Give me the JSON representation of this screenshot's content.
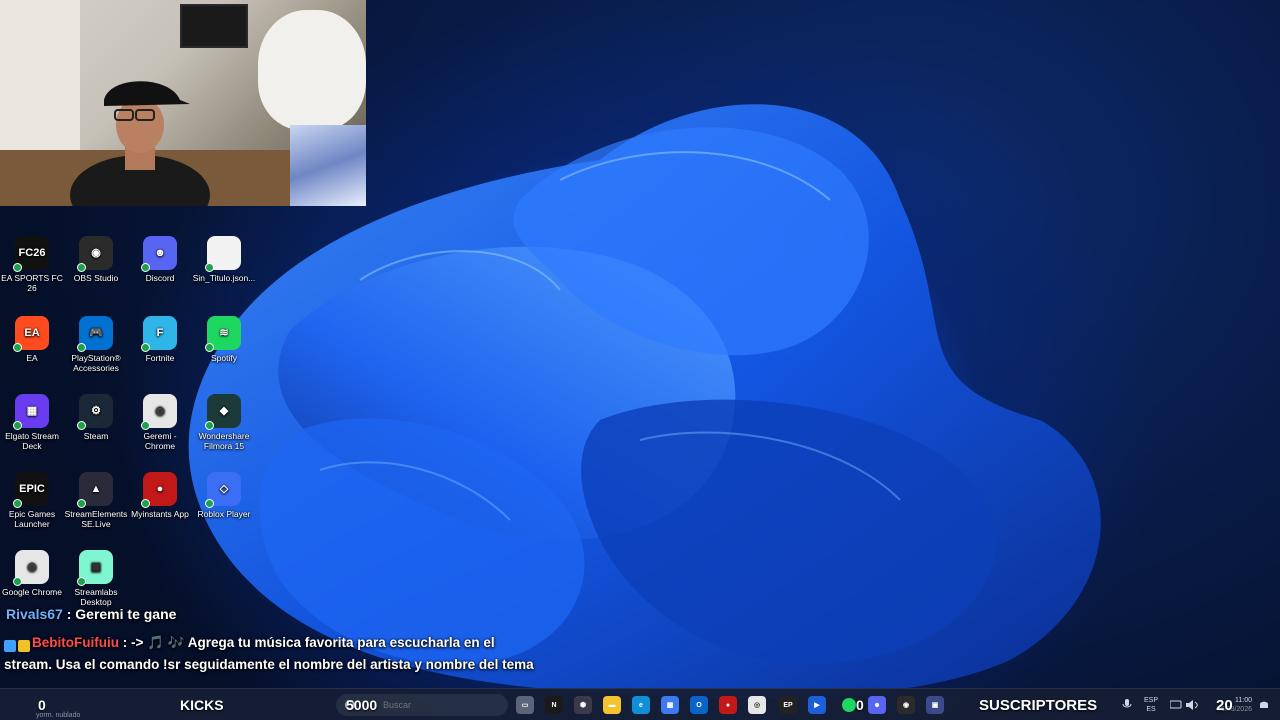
{
  "colors": {
    "accent_blue": "#1e6bff",
    "chat_user1": "#6fb0ff",
    "chat_user2": "#ff4a4a",
    "taskbar_bg": "#161e34"
  },
  "desktop_icons": [
    {
      "label": "EA SPORTS FC 26",
      "icon": "fc26-icon",
      "color": "#111111",
      "glyph": "FC26"
    },
    {
      "label": "OBS Studio",
      "icon": "obs-icon",
      "color": "#2b2b2b",
      "glyph": "◉"
    },
    {
      "label": "Discord",
      "icon": "discord-icon",
      "color": "#5865f2",
      "glyph": "☻"
    },
    {
      "label": "Sin_Titulo.json...",
      "icon": "file-icon",
      "color": "#f2f2f2",
      "glyph": ""
    },
    {
      "label": "EA",
      "icon": "ea-icon",
      "color": "#ff4b1f",
      "glyph": "EA"
    },
    {
      "label": "PlayStation® Accessories",
      "icon": "playstation-icon",
      "color": "#0070d1",
      "glyph": "🎮"
    },
    {
      "label": "Fortnite",
      "icon": "fortnite-icon",
      "color": "#2fb5e8",
      "glyph": "F"
    },
    {
      "label": "Spotify",
      "icon": "spotify-icon",
      "color": "#1ed760",
      "glyph": "≋"
    },
    {
      "label": "Elgato Stream Deck",
      "icon": "streamdeck-icon",
      "color": "#6a3cf0",
      "glyph": "▦"
    },
    {
      "label": "Steam",
      "icon": "steam-icon",
      "color": "#1b2838",
      "glyph": "⚙"
    },
    {
      "label": "Geremi - Chrome",
      "icon": "chrome-profile-icon",
      "color": "#e6e6e6",
      "glyph": "◎"
    },
    {
      "label": "Wondershare Filmora 15",
      "icon": "filmora-icon",
      "color": "#1d3a3a",
      "glyph": "◆"
    },
    {
      "label": "Epic Games Launcher",
      "icon": "epic-icon",
      "color": "#111111",
      "glyph": "EPIC"
    },
    {
      "label": "StreamElements SE.Live",
      "icon": "streamelements-icon",
      "color": "#2a2a3a",
      "glyph": "▲"
    },
    {
      "label": "Myinstants App",
      "icon": "myinstants-icon",
      "color": "#c21818",
      "glyph": "●"
    },
    {
      "label": "Roblox Player",
      "icon": "roblox-icon",
      "color": "#3b6ef5",
      "glyph": "◇"
    },
    {
      "label": "Google Chrome",
      "icon": "chrome-icon",
      "color": "#e6e6e6",
      "glyph": "◎"
    },
    {
      "label": "Streamlabs Desktop",
      "icon": "streamlabs-icon",
      "color": "#80f5d2",
      "glyph": "▣"
    }
  ],
  "chat": {
    "line1_user": "Rivals67",
    "line1_text": " : Geremi te gane",
    "line2_user": "BebitoFuifuiu",
    "line2_arrow": " : -> ",
    "line2_notes": "🎵 🎶 ",
    "line2_text": "Agrega tu música favorita para escucharla en el stream. Usa el comando !sr seguidamente el nombre del artista y nombre del tema"
  },
  "taskbar": {
    "left_counter": "0",
    "weather": "yorm. nublado",
    "kicks_label": "KICKS",
    "kicks_value": "5000",
    "search_placeholder": "Buscar",
    "apps": [
      {
        "icon": "taskview-icon",
        "color": "#5b6478",
        "glyph": "▭"
      },
      {
        "icon": "netflix-icon",
        "color": "#1a1a1a",
        "glyph": "N"
      },
      {
        "icon": "app-icon",
        "color": "#3a3a4a",
        "glyph": "⬢"
      },
      {
        "icon": "folder-icon",
        "color": "#f4c430",
        "glyph": "▬"
      },
      {
        "icon": "edge-icon",
        "color": "#0f8fd8",
        "glyph": "e"
      },
      {
        "icon": "store-icon",
        "color": "#3d7af0",
        "glyph": "▦"
      },
      {
        "icon": "outlook-icon",
        "color": "#0a64c8",
        "glyph": "O"
      },
      {
        "icon": "myinstants-taskbar-icon",
        "color": "#c21818",
        "glyph": "●"
      },
      {
        "icon": "chrome-taskbar-icon",
        "color": "#e6e6e6",
        "glyph": "◎"
      },
      {
        "icon": "epic-taskbar-icon",
        "color": "#222222",
        "glyph": "EP"
      },
      {
        "icon": "streamdeck-taskbar-icon",
        "color": "#1c5fd6",
        "glyph": "▶"
      }
    ],
    "spotify_count": "0",
    "tray_apps": [
      {
        "icon": "discord-taskbar-icon",
        "color": "#5865f2",
        "glyph": "☻"
      },
      {
        "icon": "obs-taskbar-icon",
        "color": "#2b2b2b",
        "glyph": "◉"
      },
      {
        "icon": "app-taskbar-icon",
        "color": "#3a4a8a",
        "glyph": "▣"
      }
    ],
    "subs_label": "SUSCRIPTORES",
    "lang_top": "ESP",
    "lang_bottom": "ES",
    "subs_value": "20",
    "time": "11:00",
    "date": "06/03/2026"
  }
}
